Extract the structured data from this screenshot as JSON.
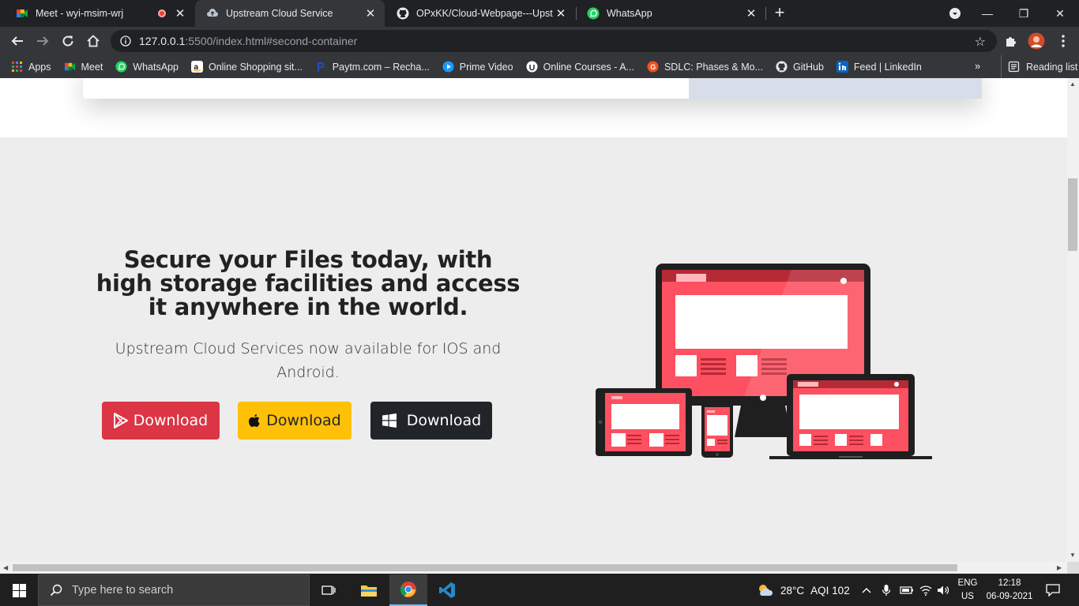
{
  "tabs": [
    {
      "title": "Meet - wyi-msim-wrj",
      "close": "✕"
    },
    {
      "title": "Upstream Cloud Service",
      "close": "✕"
    },
    {
      "title": "OPxKK/Cloud-Webpage---Upstre",
      "close": "✕"
    },
    {
      "title": "WhatsApp",
      "close": "✕"
    }
  ],
  "new_tab": "+",
  "window_controls": {
    "minimize": "—",
    "restore": "❐",
    "close": "✕"
  },
  "address": {
    "host": "127.0.0.1",
    "path": ":5500/index.html#second-container"
  },
  "bookmarks": [
    {
      "label": "Apps"
    },
    {
      "label": "Meet"
    },
    {
      "label": "WhatsApp"
    },
    {
      "label": "Online Shopping sit..."
    },
    {
      "label": "Paytm.com – Recha..."
    },
    {
      "label": "Prime Video"
    },
    {
      "label": "Online Courses - A..."
    },
    {
      "label": "SDLC: Phases & Mo..."
    },
    {
      "label": "GitHub"
    },
    {
      "label": "Feed | LinkedIn"
    }
  ],
  "bookmarks_more": "»",
  "reading_list": "Reading list",
  "page": {
    "headline": "Secure your Files today, with high storage facilities and access it anywhere in the world.",
    "subtext": "Upstream Cloud Services now available for IOS and Android.",
    "buttons": {
      "android": "Download",
      "apple": "Download",
      "windows": "Download"
    }
  },
  "taskbar": {
    "search_placeholder": "Type here to search",
    "weather": "28°C",
    "aqi": "AQI 102",
    "lang_top": "ENG",
    "lang_bottom": "US",
    "time": "12:18",
    "date": "06-09-2021"
  },
  "colors": {
    "android_btn": "#dc3545",
    "apple_btn": "#ffc107",
    "windows_btn": "#212529",
    "section_bg": "#ededed"
  }
}
